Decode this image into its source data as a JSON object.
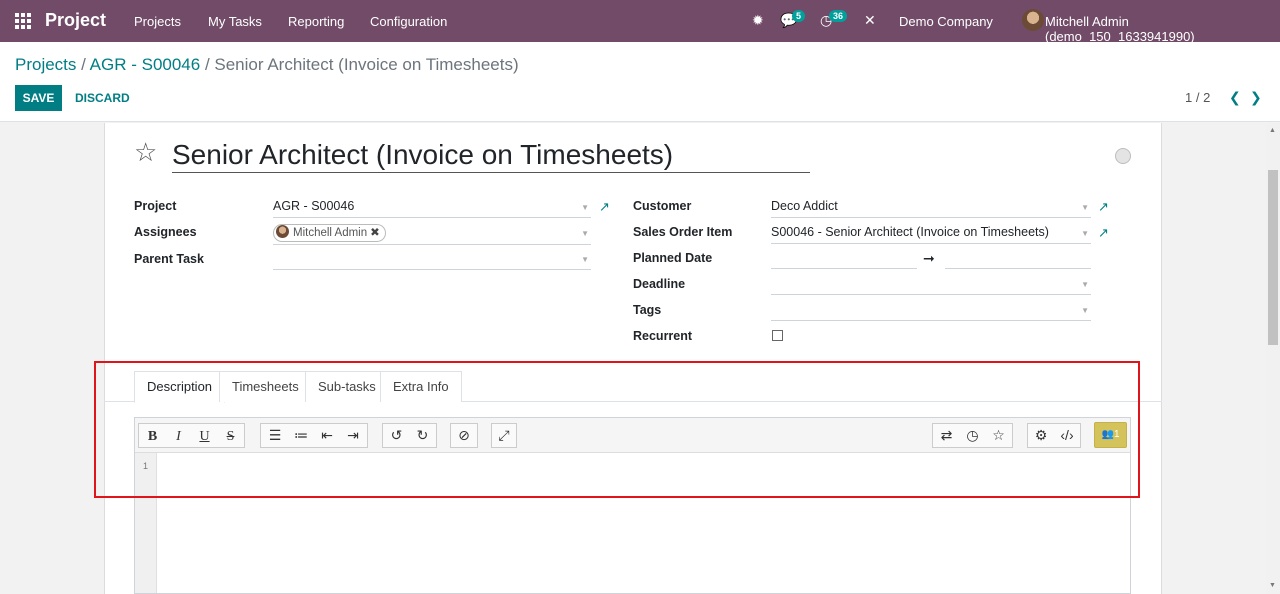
{
  "navbar": {
    "brand": "Project",
    "menu": [
      "Projects",
      "My Tasks",
      "Reporting",
      "Configuration"
    ],
    "messages_count": "5",
    "activities_count": "36",
    "company": "Demo Company",
    "user": "Mitchell Admin (demo_150_1633941990)"
  },
  "breadcrumb": {
    "root": "Projects",
    "sep1": " / ",
    "project": "AGR - S00046",
    "sep2": " / ",
    "current": "Senior Architect (Invoice on Timesheets)"
  },
  "buttons": {
    "save": "SAVE",
    "discard": "DISCARD"
  },
  "pager": {
    "text": "1 / 2"
  },
  "task": {
    "title": "Senior Architect (Invoice on Timesheets)",
    "fields": {
      "project_label": "Project",
      "project_value": "AGR - S00046",
      "assignees_label": "Assignees",
      "assignee": "Mitchell Admin",
      "parent_label": "Parent Task",
      "parent_value": "",
      "customer_label": "Customer",
      "customer_value": "Deco Addict",
      "soi_label": "Sales Order Item",
      "soi_value": "S00046 - Senior Architect (Invoice on Timesheets)",
      "planned_label": "Planned Date",
      "deadline_label": "Deadline",
      "tags_label": "Tags",
      "recurrent_label": "Recurrent"
    }
  },
  "tabs": [
    "Description",
    "Timesheets",
    "Sub-tasks",
    "Extra Info"
  ],
  "editor": {
    "line_number": "1",
    "collaborators": "1"
  },
  "colors": {
    "navbar": "#714b67",
    "primary": "#017e84",
    "highlight_border": "#e0151b"
  }
}
